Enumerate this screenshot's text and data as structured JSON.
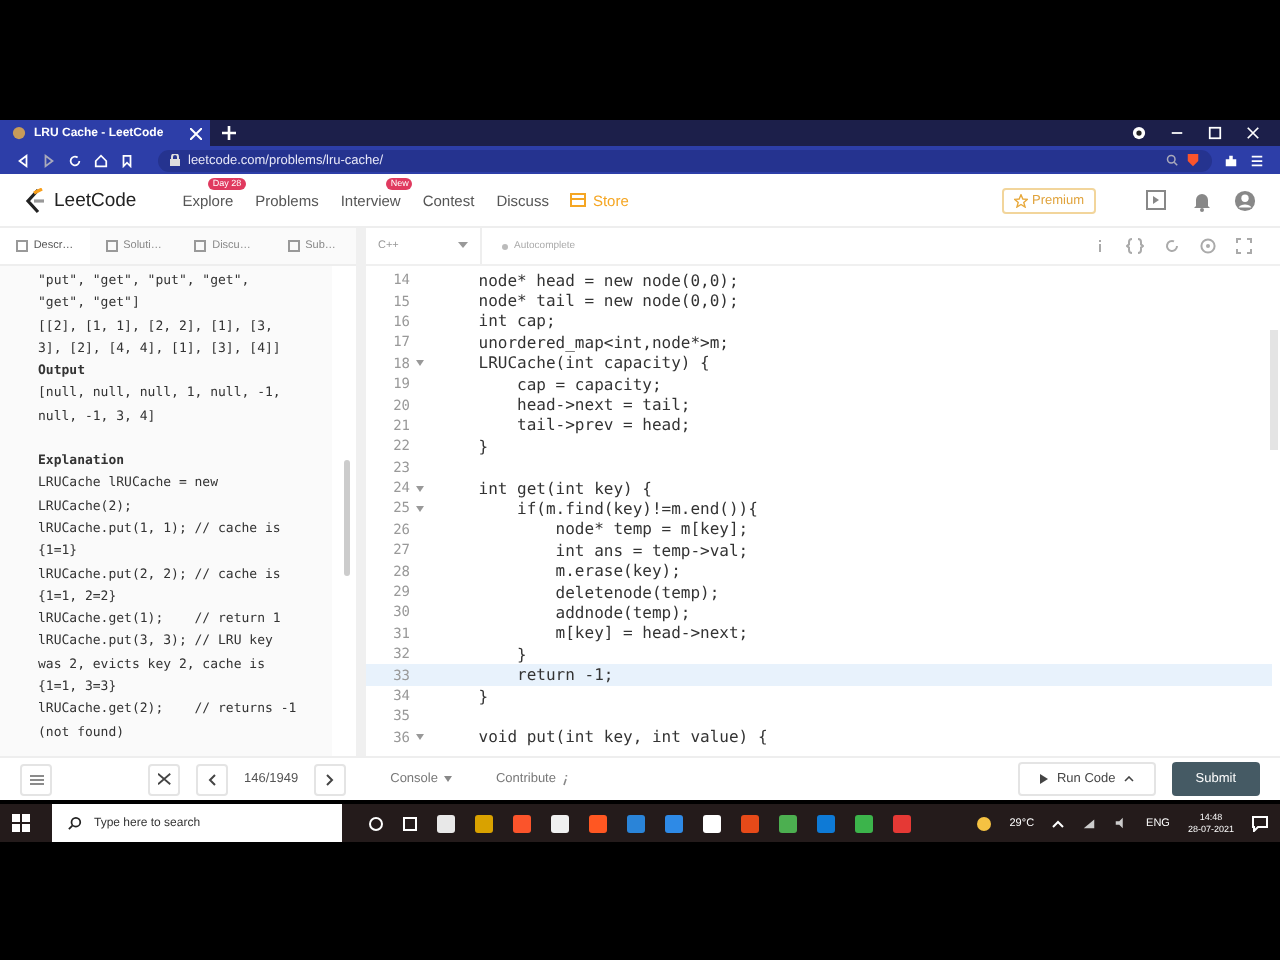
{
  "browser": {
    "tab_title": "LRU Cache - LeetCode",
    "url": "leetcode.com/problems/lru-cache/"
  },
  "nav": {
    "logo": "LeetCode",
    "items": [
      {
        "label": "Explore",
        "badge": "Day 28",
        "highlighted": false
      },
      {
        "label": "Problems",
        "highlighted": false
      },
      {
        "label": "Interview",
        "badge": "New",
        "highlighted": false
      },
      {
        "label": "Contest",
        "highlighted": false
      },
      {
        "label": "Discuss",
        "highlighted": false
      },
      {
        "label": "Store",
        "highlighted": true
      }
    ],
    "premium": "Premium"
  },
  "panel_tabs": [
    {
      "label": "Descr…",
      "selected": true
    },
    {
      "label": "Soluti…",
      "selected": false
    },
    {
      "label": "Discu…",
      "selected": false
    },
    {
      "label": "Sub…",
      "selected": false
    }
  ],
  "description": [
    {
      "kind": "code",
      "text": "\"put\", \"get\", \"put\", \"get\","
    },
    {
      "kind": "code",
      "text": "\"get\", \"get\"]"
    },
    {
      "kind": "code",
      "text": "[[2], [1, 1], [2, 2], [1], [3,"
    },
    {
      "kind": "code",
      "text": "3], [2], [4, 4], [1], [3], [4]]"
    },
    {
      "kind": "heading",
      "text": "Output"
    },
    {
      "kind": "code",
      "text": "[null, null, null, 1, null, -1,"
    },
    {
      "kind": "code",
      "text": "null, -1, 3, 4]"
    },
    {
      "kind": "section",
      "text": "Explanation"
    },
    {
      "kind": "code",
      "text": "LRUCache lRUCache = new"
    },
    {
      "kind": "code",
      "text": "LRUCache(2);"
    },
    {
      "kind": "code",
      "text": "lRUCache.put(1, 1); // cache is"
    },
    {
      "kind": "code",
      "text": "{1=1}"
    },
    {
      "kind": "code",
      "text": "lRUCache.put(2, 2); // cache is"
    },
    {
      "kind": "code",
      "text": "{1=1, 2=2}"
    },
    {
      "kind": "code",
      "text": "lRUCache.get(1);    // return 1"
    },
    {
      "kind": "code",
      "text": "lRUCache.put(3, 3); // LRU key"
    },
    {
      "kind": "code",
      "text": "was 2, evicts key 2, cache is"
    },
    {
      "kind": "code",
      "text": "{1=1, 3=3}"
    },
    {
      "kind": "code",
      "text": "lRUCache.get(2);    // returns -1"
    },
    {
      "kind": "code",
      "text": "(not found)"
    }
  ],
  "editor": {
    "language": "C++",
    "autocomplete": "Autocomplete",
    "lines": [
      {
        "number": "14",
        "text": "    node* head = new node(0,0);",
        "foldable": false,
        "highlighted": false
      },
      {
        "number": "15",
        "text": "    node* tail = new node(0,0);",
        "foldable": false,
        "highlighted": false
      },
      {
        "number": "16",
        "text": "    int cap;",
        "foldable": false,
        "highlighted": false
      },
      {
        "number": "17",
        "text": "    unordered_map<int,node*>m;",
        "foldable": false,
        "highlighted": false
      },
      {
        "number": "18",
        "text": "    LRUCache(int capacity) {",
        "foldable": true,
        "highlighted": false
      },
      {
        "number": "19",
        "text": "        cap = capacity;",
        "foldable": false,
        "highlighted": false
      },
      {
        "number": "20",
        "text": "        head->next = tail;",
        "foldable": false,
        "highlighted": false
      },
      {
        "number": "21",
        "text": "        tail->prev = head;",
        "foldable": false,
        "highlighted": false
      },
      {
        "number": "22",
        "text": "    }",
        "foldable": false,
        "highlighted": false
      },
      {
        "number": "23",
        "foldable": false,
        "highlighted": false
      },
      {
        "number": "24",
        "text": "    int get(int key) {",
        "foldable": true,
        "highlighted": false
      },
      {
        "number": "25",
        "text": "        if(m.find(key)!=m.end()){",
        "foldable": true,
        "highlighted": false
      },
      {
        "number": "26",
        "text": "            node* temp = m[key];",
        "foldable": false,
        "highlighted": false
      },
      {
        "number": "27",
        "text": "            int ans = temp->val;",
        "foldable": false,
        "highlighted": false
      },
      {
        "number": "28",
        "text": "            m.erase(key);",
        "foldable": false,
        "highlighted": false
      },
      {
        "number": "29",
        "text": "            deletenode(temp);",
        "foldable": false,
        "highlighted": false
      },
      {
        "number": "30",
        "text": "            addnode(temp);",
        "foldable": false,
        "highlighted": false
      },
      {
        "number": "31",
        "text": "            m[key] = head->next;",
        "foldable": false,
        "highlighted": false
      },
      {
        "number": "32",
        "text": "        }",
        "foldable": false,
        "highlighted": false
      },
      {
        "number": "33",
        "text": "        return -1;",
        "foldable": false,
        "highlighted": true
      },
      {
        "number": "34",
        "text": "    }",
        "foldable": false,
        "highlighted": false
      },
      {
        "number": "35",
        "foldable": false,
        "highlighted": false
      },
      {
        "number": "36",
        "text": "    void put(int key, int value) {",
        "foldable": true,
        "highlighted": false
      }
    ]
  },
  "footer": {
    "counter": "146/1949",
    "console": "Console",
    "contribute": "Contribute",
    "run": "Run Code",
    "submit": "Submit"
  },
  "taskbar": {
    "search_placeholder": "Type here to search",
    "weather": "29°C",
    "language": "ENG",
    "time": "14:48",
    "date": "28-07-2021"
  }
}
